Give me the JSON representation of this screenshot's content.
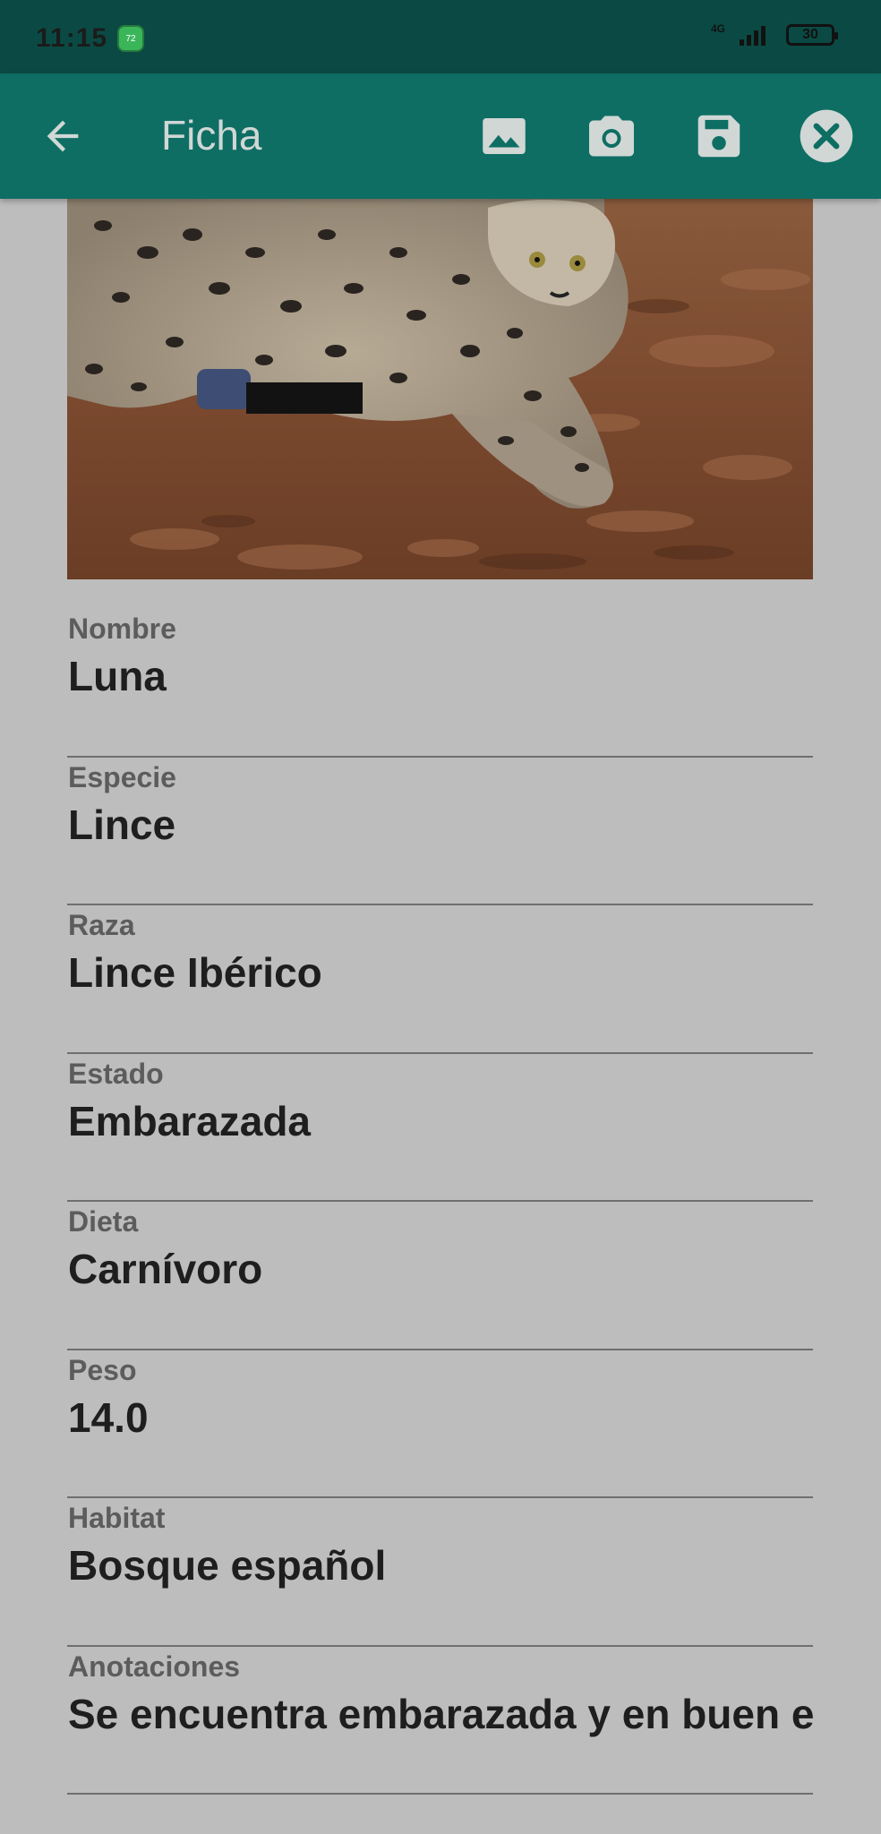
{
  "status_bar": {
    "time": "11:15",
    "network": "4G",
    "battery": "30"
  },
  "app_bar": {
    "title": "Ficha",
    "icons": {
      "back": "arrow-back-icon",
      "gallery": "image-icon",
      "camera": "camera-icon",
      "save": "save-icon",
      "close": "close-icon"
    }
  },
  "photo": {
    "alt": "lince"
  },
  "fields": [
    {
      "label": "Nombre",
      "value": "Luna"
    },
    {
      "label": "Especie",
      "value": "Lince"
    },
    {
      "label": "Raza",
      "value": "Lince Ibérico"
    },
    {
      "label": "Estado",
      "value": "Embarazada"
    },
    {
      "label": "Dieta",
      "value": "Carnívoro"
    },
    {
      "label": "Peso",
      "value": "14.0"
    },
    {
      "label": "Habitat",
      "value": "Bosque español"
    },
    {
      "label": "Anotaciones",
      "value": "Se encuentra embarazada y en buen estado"
    }
  ],
  "colors": {
    "status_bar": "#0b4a44",
    "app_bar": "#0e6e63",
    "background": "#bdbdbd"
  }
}
